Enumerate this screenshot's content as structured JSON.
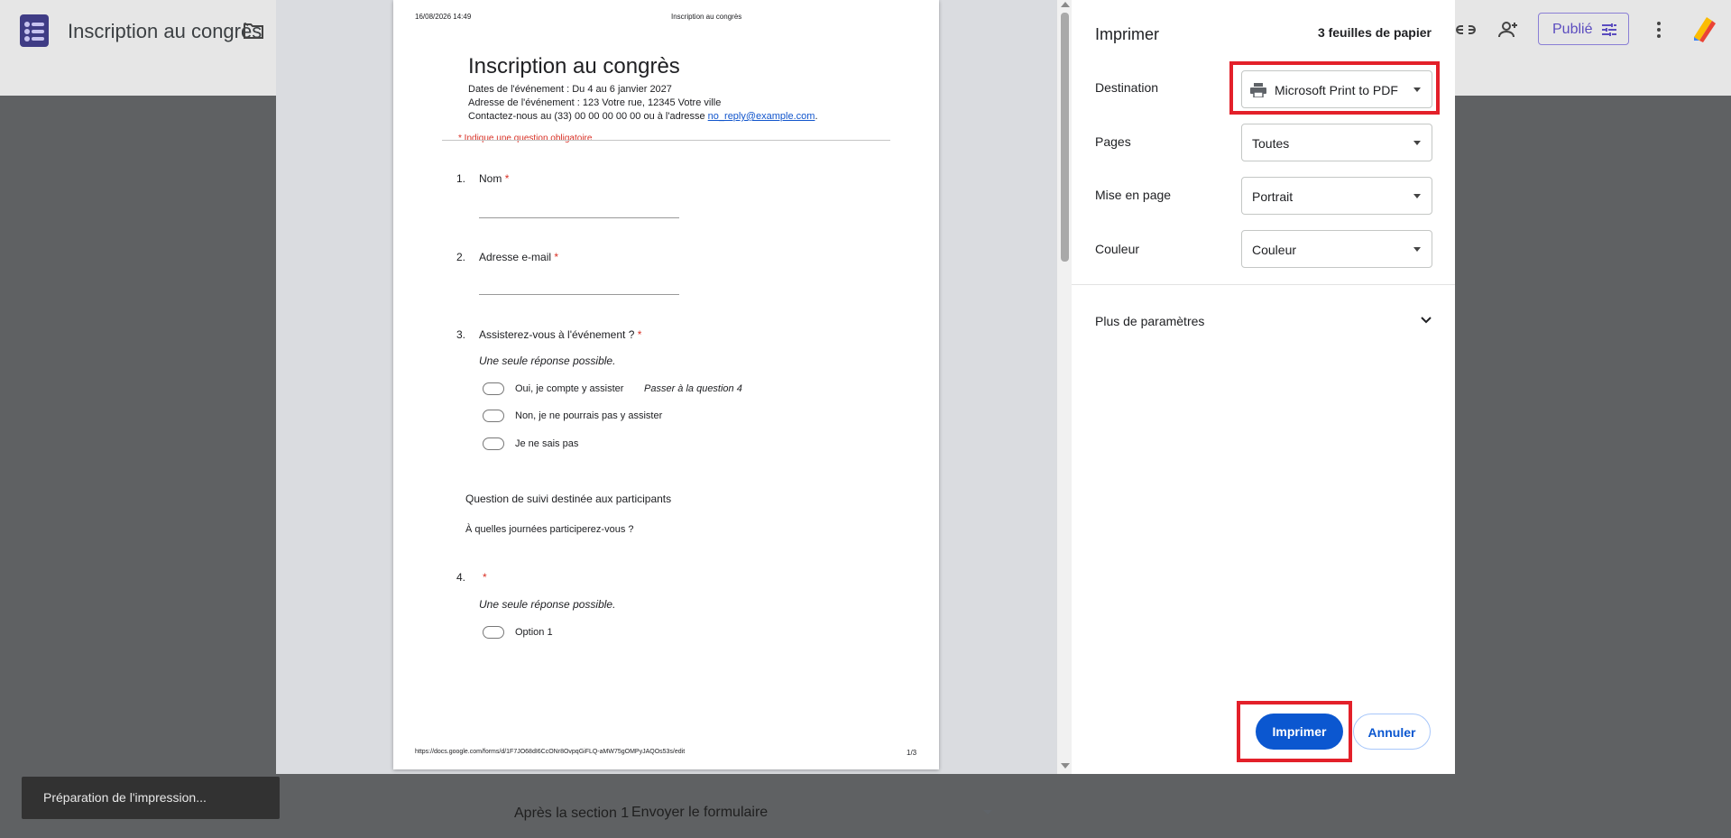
{
  "app": {
    "title": "Inscription au congrès",
    "publish_label": "Publié"
  },
  "background": {
    "after_section_label": "Après la section 1",
    "after_section_value": "Envoyer le formulaire"
  },
  "toast": "Préparation de l'impression...",
  "preview": {
    "header_date": "16/08/2026 14:49",
    "header_title": "Inscription au congrès",
    "form_title": "Inscription au congrès",
    "desc_line1": "Dates de l'événement : Du 4 au 6 janvier 2027",
    "desc_line2": "Adresse de l'événement : 123 Votre rue, 12345 Votre ville",
    "desc_line3_prefix": "Contactez-nous au (33) 00 00 00 00 00 ou à l'adresse ",
    "desc_email": "no_reply@example.com",
    "desc_line3_suffix": ".",
    "required_note": "* Indique une question obligatoire",
    "questions": [
      {
        "num": "1.",
        "label": "Nom",
        "required": "*"
      },
      {
        "num": "2.",
        "label": "Adresse e-mail",
        "required": "*"
      },
      {
        "num": "3.",
        "label": "Assisterez-vous à l'événement ?",
        "required": "*",
        "hint": "Une seule réponse possible.",
        "options": [
          {
            "label": "Oui, je compte y assister",
            "note": "Passer à la question 4"
          },
          {
            "label": "Non, je ne pourrais pas y assister",
            "note": ""
          },
          {
            "label": "Je ne sais pas",
            "note": ""
          }
        ]
      },
      {
        "num": "4.",
        "label": "",
        "required": "*",
        "hint": "Une seule réponse possible.",
        "options": [
          {
            "label": "Option 1",
            "note": ""
          }
        ]
      }
    ],
    "section_title": "Question de suivi destinée aux participants",
    "section_desc": "À quelles journées participerez-vous ?",
    "footer_url": "https://docs.google.com/forms/d/1F7JO68dI6CcONr8OvpqGiFLQ-aMW75gOMPyJAQOs53s/edit",
    "footer_page": "1/3"
  },
  "print": {
    "title": "Imprimer",
    "sheets": "3 feuilles de papier",
    "destination_label": "Destination",
    "destination_value": "Microsoft Print to PDF",
    "pages_label": "Pages",
    "pages_value": "Toutes",
    "layout_label": "Mise en page",
    "layout_value": "Portrait",
    "color_label": "Couleur",
    "color_value": "Couleur",
    "more_settings": "Plus de paramètres",
    "print_button": "Imprimer",
    "cancel_button": "Annuler"
  }
}
